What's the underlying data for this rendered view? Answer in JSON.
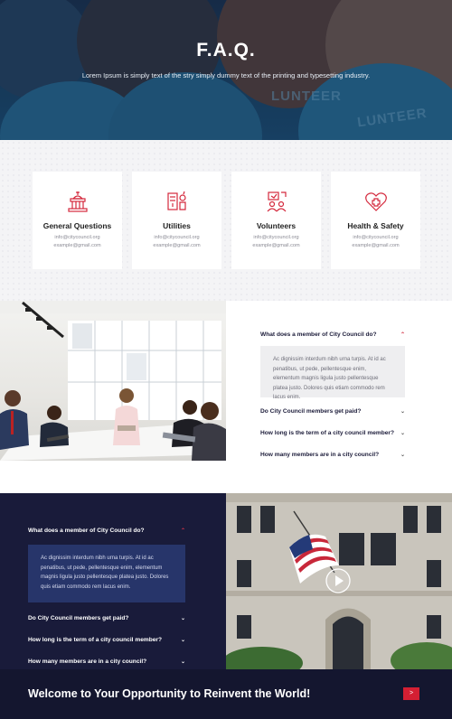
{
  "hero": {
    "title": "F.A.Q.",
    "subtitle": "Lorem Ipsum is simply text of the stry simply dummy text of the printing and typesetting industry.",
    "shirt_text_1": "LUNTEER",
    "shirt_text_2": "LUNTEER"
  },
  "cards": [
    {
      "icon": "city-hall-icon",
      "title": "General Questions",
      "line1": "info@citycouncil.org",
      "line2": "example@gmail.com"
    },
    {
      "icon": "utilities-icon",
      "title": "Utilities",
      "line1": "info@citycouncil.org",
      "line2": "example@gmail.com"
    },
    {
      "icon": "volunteers-icon",
      "title": "Volunteers",
      "line1": "info@citycouncil.org",
      "line2": "example@gmail.com"
    },
    {
      "icon": "health-safety-icon",
      "title": "Health & Safety",
      "line1": "info@citycouncil.org",
      "line2": "example@gmail.com"
    }
  ],
  "faq_light": {
    "items": [
      {
        "question": "What does a member of City Council do?",
        "open": true
      },
      {
        "question": "Do City Council members get paid?"
      },
      {
        "question": "How long is the term of a city council member?"
      },
      {
        "question": "How many members are in a city council?"
      }
    ],
    "answer": "Ac dignissim interdum nibh urna turpis. At id ac penatibus, ut pede, pellentesque enim, elementum magnis ligula justo pellentesque platea justo. Dolores quis etiam commodo rem lacus enim."
  },
  "faq_dark": {
    "items": [
      {
        "question": "What does a member of City Council do?",
        "open": true
      },
      {
        "question": "Do City Council members get paid?"
      },
      {
        "question": "How long is the term of a city council member?"
      },
      {
        "question": "How many members are in a city council?"
      }
    ],
    "answer": "Ac dignissim interdum nibh urna turpis. At id ac penatibus, ut pede, pellentesque enim, elementum magnis ligula justo pellentesque platea justo. Dolores quis etiam commodo rem lacus enim."
  },
  "cta": {
    "headline": "Welcome to Your Opportunity to Reinvent the World!",
    "button_label": ">"
  },
  "colors": {
    "accent": "#d41f33",
    "navy": "#191b3a",
    "answer_dark": "#27356a"
  }
}
